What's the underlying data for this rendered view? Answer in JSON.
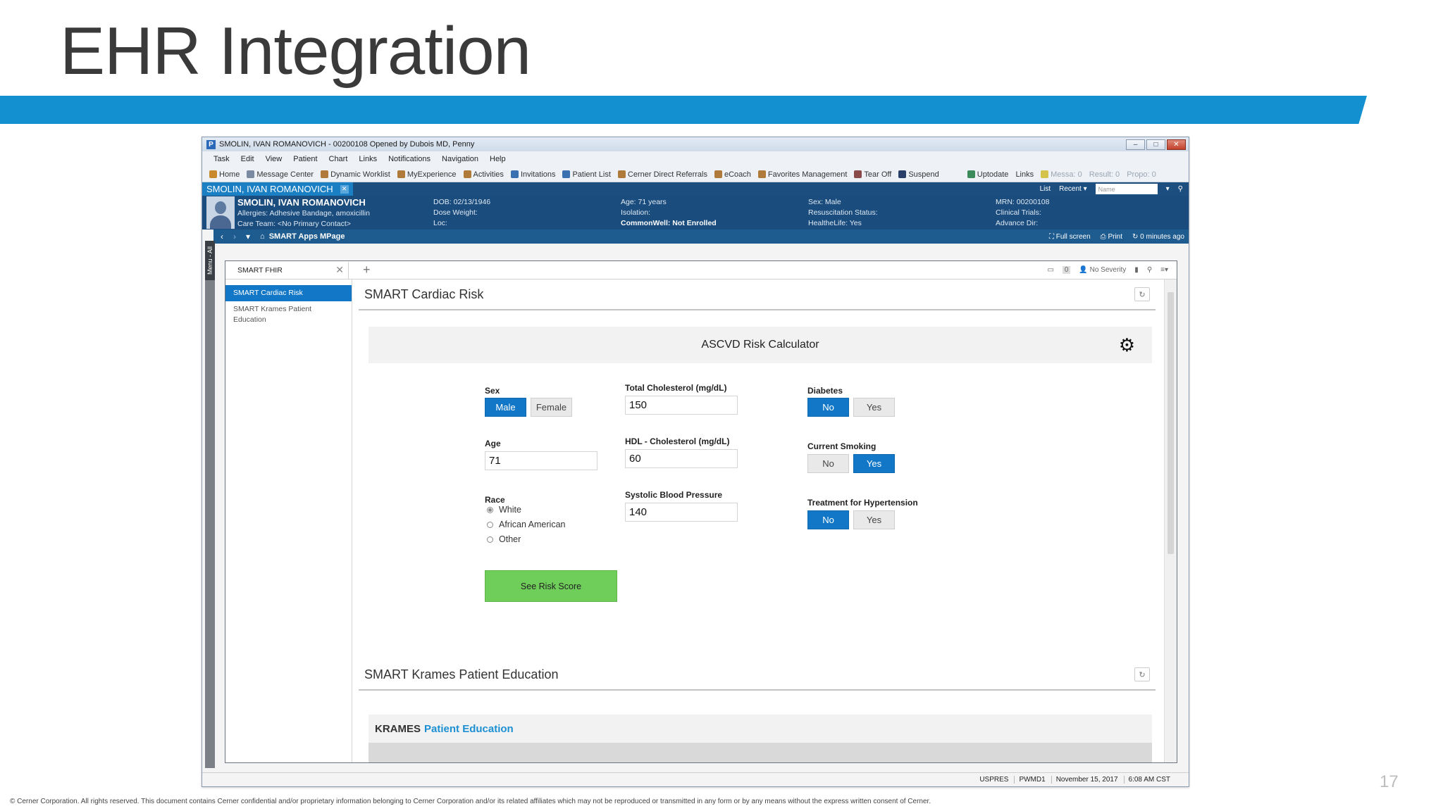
{
  "slide": {
    "title": "EHR Integration",
    "page_number": "17",
    "footer": "© Cerner Corporation.  All rights reserved.  This document contains Cerner confidential and/or proprietary information belonging to Cerner Corporation and/or its related affiliates which may not be reproduced or transmitted in any form or by any means without the express written consent of Cerner.",
    "banner_color": "#1390d0"
  },
  "window": {
    "title": "SMOLIN, IVAN ROMANOVICH - 00200108 Opened by Dubois MD, Penny",
    "app_icon": "P"
  },
  "menubar": [
    "Task",
    "Edit",
    "View",
    "Patient",
    "Chart",
    "Links",
    "Notifications",
    "Navigation",
    "Help"
  ],
  "toolbar": {
    "items": [
      {
        "label": "Home",
        "icon": "home-icon"
      },
      {
        "label": "Message Center",
        "icon": "message-icon"
      },
      {
        "label": "Dynamic Worklist",
        "icon": "worklist-icon"
      },
      {
        "label": "MyExperience",
        "icon": "experience-icon"
      },
      {
        "label": "Activities",
        "icon": "activities-icon"
      },
      {
        "label": "Invitations",
        "icon": "invitations-icon"
      },
      {
        "label": "Patient List",
        "icon": "patient-list-icon"
      },
      {
        "label": "Cerner Direct Referrals",
        "icon": "referrals-icon"
      },
      {
        "label": "eCoach",
        "icon": "ecoach-icon"
      },
      {
        "label": "Favorites Management",
        "icon": "favorites-icon"
      },
      {
        "label": "Tear Off",
        "icon": "tear-off-icon"
      },
      {
        "label": "Suspend",
        "icon": "suspend-icon"
      },
      {
        "label": "Uptodate",
        "icon": "uptodate-icon"
      },
      {
        "label": "Links",
        "icon": "links-icon"
      }
    ],
    "counters": [
      "Messa: 0",
      "Result: 0",
      "Propo: 0"
    ]
  },
  "patient_bar": {
    "tab_name": "SMOLIN, IVAN ROMANOVICH",
    "list_label": "List",
    "recent_label": "Recent",
    "name_placeholder": "Name"
  },
  "banner": {
    "name": "SMOLIN, IVAN ROMANOVICH",
    "allergies": "Allergies: Adhesive Bandage, amoxicillin",
    "care_team": "Care Team: <No Primary Contact>",
    "dob": "DOB: 02/13/1946",
    "dose_weight": "Dose Weight:",
    "loc": "Loc:",
    "age": "Age: 71 years",
    "isolation": "Isolation:",
    "commonwell": "CommonWell: Not Enrolled",
    "sex": "Sex: Male",
    "resuscitation": "Resuscitation Status:",
    "healthelife": "HealtheLife: Yes",
    "mrn": "MRN: 00200108",
    "clinical_trials": "Clinical Trials:",
    "advance_dir": "Advance Dir:"
  },
  "mpage_bar": {
    "title": "SMART Apps MPage",
    "full_screen": "Full screen",
    "print": "Print",
    "updated": "0 minutes ago"
  },
  "menu_all": "Menu - All",
  "tab": {
    "label": "SMART FHIR",
    "no_severity": "No Severity",
    "badge_count": "0"
  },
  "sidebar": [
    "SMART Cardiac Risk",
    "SMART Krames Patient Education"
  ],
  "cardiac": {
    "section_title": "SMART Cardiac Risk",
    "calc_title": "ASCVD Risk Calculator",
    "sex_label": "Sex",
    "sex_male": "Male",
    "sex_female": "Female",
    "age_label": "Age",
    "age_value": "71",
    "race_label": "Race",
    "race_options": [
      "White",
      "African American",
      "Other"
    ],
    "total_chol_label": "Total Cholesterol (mg/dL)",
    "total_chol_value": "150",
    "hdl_label": "HDL - Cholesterol (mg/dL)",
    "hdl_value": "60",
    "sbp_label": "Systolic Blood Pressure",
    "sbp_value": "140",
    "diabetes_label": "Diabetes",
    "smoking_label": "Current Smoking",
    "hypertension_label": "Treatment for Hypertension",
    "no": "No",
    "yes": "Yes",
    "risk_button": "See Risk Score"
  },
  "krames": {
    "section_title": "SMART Krames Patient Education",
    "brand": "KRAMES",
    "subtitle": "Patient Education"
  },
  "statusbar": [
    "USPRES",
    "PWMD1",
    "November 15, 2017",
    "6:08 AM CST"
  ]
}
